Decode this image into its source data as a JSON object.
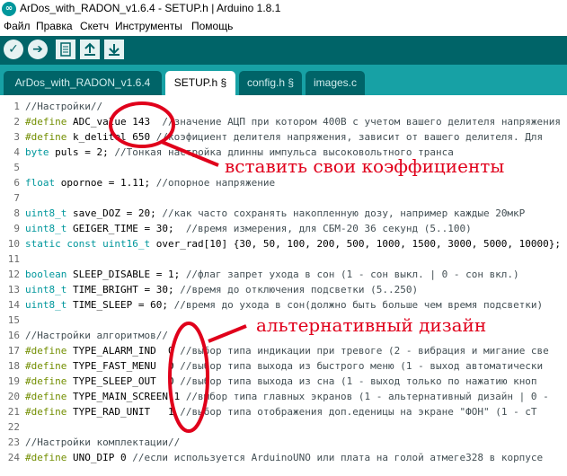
{
  "window": {
    "title": "ArDos_with_RADON_v1.6.4 - SETUP.h | Arduino 1.8.1",
    "app_icon": "arduino-icon"
  },
  "menu": [
    "Файл",
    "Правка",
    "Скетч",
    "Инструменты",
    "Помощь"
  ],
  "toolbar": {
    "buttons": [
      {
        "name": "verify-icon",
        "glyph": "✓"
      },
      {
        "name": "upload-icon",
        "glyph": "➔"
      },
      {
        "name": "new-file-icon"
      },
      {
        "name": "open-icon"
      },
      {
        "name": "save-icon"
      }
    ]
  },
  "tabs": [
    {
      "label": "ArDos_with_RADON_v1.6.4",
      "active": false
    },
    {
      "label": "SETUP.h §",
      "active": true
    },
    {
      "label": "config.h §",
      "active": false
    },
    {
      "label": "images.c",
      "active": false
    }
  ],
  "code_lines": [
    {
      "n": "1",
      "parts": [
        {
          "t": "//Настройки//",
          "c": "cm"
        }
      ]
    },
    {
      "n": "2",
      "parts": [
        {
          "t": "#define",
          "c": "kw"
        },
        {
          "t": " ADC_value 143  ",
          "c": ""
        },
        {
          "t": "//значение АЦП при котором 400В с учетом вашего делителя напряжения",
          "c": "cm"
        }
      ]
    },
    {
      "n": "3",
      "parts": [
        {
          "t": "#define",
          "c": "kw"
        },
        {
          "t": " k_delitel 650 ",
          "c": ""
        },
        {
          "t": "//коэфициент делителя напряжения, зависит от вашего делителя. Для",
          "c": "cm"
        }
      ]
    },
    {
      "n": "4",
      "parts": [
        {
          "t": "byte",
          "c": "ty"
        },
        {
          "t": " puls = 2; ",
          "c": ""
        },
        {
          "t": "//Тонкая настройка длинны импульса высоковольтного транса",
          "c": "cm"
        }
      ]
    },
    {
      "n": "5",
      "parts": []
    },
    {
      "n": "6",
      "parts": [
        {
          "t": "float",
          "c": "ty"
        },
        {
          "t": " opornoe = 1.11; ",
          "c": ""
        },
        {
          "t": "//опорное напряжение",
          "c": "cm"
        }
      ]
    },
    {
      "n": "7",
      "parts": []
    },
    {
      "n": "8",
      "parts": [
        {
          "t": "uint8_t",
          "c": "ty"
        },
        {
          "t": " save_DOZ = 20; ",
          "c": ""
        },
        {
          "t": "//как часто сохранять накопленную дозу, например каждые 20мкР",
          "c": "cm"
        }
      ]
    },
    {
      "n": "9",
      "parts": [
        {
          "t": "uint8_t",
          "c": "ty"
        },
        {
          "t": " GEIGER_TIME = 30;  ",
          "c": ""
        },
        {
          "t": "//время измерения, для СБМ-20 36 секунд (5..100)",
          "c": "cm"
        }
      ]
    },
    {
      "n": "10",
      "parts": [
        {
          "t": "static const uint16_t",
          "c": "ty"
        },
        {
          "t": " over_rad[10] {30, 50, 100, 200, 500, 1000, 1500, 3000, 5000, 10000};",
          "c": ""
        }
      ]
    },
    {
      "n": "11",
      "parts": []
    },
    {
      "n": "12",
      "parts": [
        {
          "t": "boolean",
          "c": "ty"
        },
        {
          "t": " SLEEP_DISABLE = 1; ",
          "c": ""
        },
        {
          "t": "//флаг запрет ухода в сон (1 - сон выкл. | 0 - сон вкл.)",
          "c": "cm"
        }
      ]
    },
    {
      "n": "13",
      "parts": [
        {
          "t": "uint8_t",
          "c": "ty"
        },
        {
          "t": " TIME_BRIGHT = 30; ",
          "c": ""
        },
        {
          "t": "//время до отключения подсветки (5..250)",
          "c": "cm"
        }
      ]
    },
    {
      "n": "14",
      "parts": [
        {
          "t": "uint8_t",
          "c": "ty"
        },
        {
          "t": " TIME_SLEEP = 60; ",
          "c": ""
        },
        {
          "t": "//время до ухода в сон(должно быть больше чем время подсветки)",
          "c": "cm"
        }
      ]
    },
    {
      "n": "15",
      "parts": []
    },
    {
      "n": "16",
      "parts": [
        {
          "t": "//Настройки алгоритмов//",
          "c": "cm"
        }
      ]
    },
    {
      "n": "17",
      "parts": [
        {
          "t": "#define",
          "c": "kw"
        },
        {
          "t": " TYPE_ALARM_IND  0 ",
          "c": ""
        },
        {
          "t": "//выбор типа индикации при тревоге (2 - вибрация и мигание све",
          "c": "cm"
        }
      ]
    },
    {
      "n": "18",
      "parts": [
        {
          "t": "#define",
          "c": "kw"
        },
        {
          "t": " TYPE_FAST_MENU  0 ",
          "c": ""
        },
        {
          "t": "//выбор типа выхода из быстрого меню (1 - выход автоматически",
          "c": "cm"
        }
      ]
    },
    {
      "n": "19",
      "parts": [
        {
          "t": "#define",
          "c": "kw"
        },
        {
          "t": " TYPE_SLEEP_OUT  0 ",
          "c": ""
        },
        {
          "t": "//выбор типа выхода из сна (1 - выход только по нажатию кноп",
          "c": "cm"
        }
      ]
    },
    {
      "n": "20",
      "parts": [
        {
          "t": "#define",
          "c": "kw"
        },
        {
          "t": " TYPE_MAIN_SCREEN 1 ",
          "c": ""
        },
        {
          "t": "//выбор типа главных экранов (1 - альтернативный дизайн | 0 -",
          "c": "cm"
        }
      ]
    },
    {
      "n": "21",
      "parts": [
        {
          "t": "#define",
          "c": "kw"
        },
        {
          "t": " TYPE_RAD_UNIT   1 ",
          "c": ""
        },
        {
          "t": "//выбор типа отображения доп.еденицы на экране \"ФОН\" (1 - cT",
          "c": "cm"
        }
      ]
    },
    {
      "n": "22",
      "parts": []
    },
    {
      "n": "23",
      "parts": [
        {
          "t": "//Настройки комплектации//",
          "c": "cm"
        }
      ]
    },
    {
      "n": "24",
      "parts": [
        {
          "t": "#define",
          "c": "kw"
        },
        {
          "t": " UNO_DIP 0 ",
          "c": ""
        },
        {
          "t": "//если используется ArduinoUNO или плата на голой атмеге328 в корпусе",
          "c": "cm"
        }
      ]
    }
  ],
  "annotations": {
    "coefficients_note": "вставить свои коэффициенты",
    "design_note": "альтернативный дизайн",
    "color": "#e0001b"
  },
  "colors": {
    "toolbar": "#006468",
    "tabbar": "#17a1a5",
    "keyword": "#728e00",
    "type": "#00979c",
    "comment": "#434f54"
  }
}
